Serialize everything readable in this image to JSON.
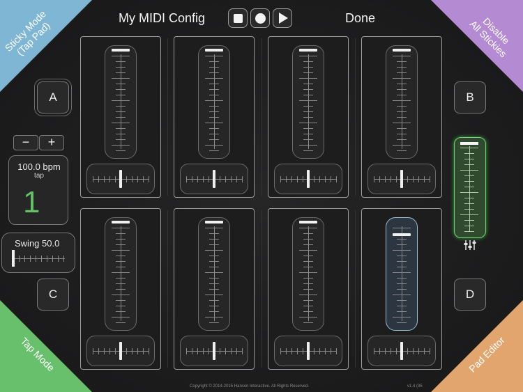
{
  "header": {
    "title": "My MIDI Config",
    "done_label": "Done"
  },
  "transport": {
    "stop_icon": "stop-icon",
    "record_icon": "record-icon",
    "play_icon": "play-icon"
  },
  "corners": {
    "top_left": {
      "line1": "Sticky Mode",
      "line2": "(Tap Pad)",
      "color": "#7eb6d3"
    },
    "top_right": {
      "line1": "Disable",
      "line2": "All Stickies",
      "color": "#b48bd2"
    },
    "bottom_left": {
      "label": "Tap Mode",
      "color": "#69c06c"
    },
    "bottom_right": {
      "label": "Pad Editor",
      "color": "#e2a56e"
    }
  },
  "side_buttons": {
    "a": "A",
    "b": "B",
    "c": "C",
    "d": "D"
  },
  "tempo": {
    "minus": "−",
    "plus": "+",
    "bpm": "100.0 bpm",
    "tap": "tap",
    "beat": "1",
    "beat_color": "#66c266"
  },
  "swing": {
    "label": "Swing 50.0",
    "value": 0
  },
  "pads": [
    {
      "fader": 1.0,
      "pan": 0.5,
      "active": false
    },
    {
      "fader": 1.0,
      "pan": 0.5,
      "active": false
    },
    {
      "fader": 1.0,
      "pan": 0.5,
      "active": false
    },
    {
      "fader": 1.0,
      "pan": 0.5,
      "active": false
    },
    {
      "fader": 1.0,
      "pan": 0.5,
      "active": false
    },
    {
      "fader": 1.0,
      "pan": 0.5,
      "active": false
    },
    {
      "fader": 1.0,
      "pan": 0.5,
      "active": false
    },
    {
      "fader": 0.87,
      "pan": 0.5,
      "active": true
    }
  ],
  "master": {
    "level": 1.0,
    "color": "#6fd36f",
    "icon": "mixer-sliders-icon"
  },
  "footer": {
    "copyright": "Copyright © 2014-2015 Hanson Interactive. All Rights Reserved.",
    "version": "v1.4 (35"
  }
}
